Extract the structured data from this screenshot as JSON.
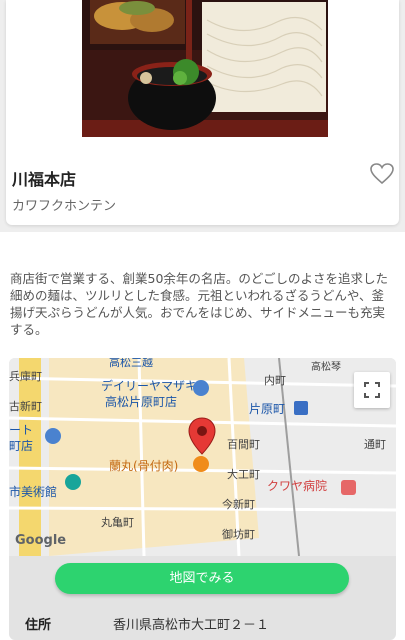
{
  "shop": {
    "name": "川福本店",
    "kana": "カワフクホンテン",
    "description": "商店街で営業する、創業50余年の名店。のどごしのよさを追求した細めの麺は、ツルリとした食感。元祖といわれるざるうどんや、釜揚げ天ぷらうどんが人気。おでんをはじめ、サイドメニューも充実する。"
  },
  "map": {
    "labels": {
      "top_cut": "高松三越",
      "kita": "兵庫町",
      "yamazaki1": "デイリーヤマザキ",
      "yamazaki2": "高松片原町店",
      "uchimachi": "内町",
      "takamatsu_line": "高松琴",
      "katahara_left": "古新町",
      "katahara": "片原町",
      "hyakkenmachi": "百間町",
      "toorimachi": "通町",
      "store_left1": "ート",
      "store_left2": "町店",
      "ranmaru": "蘭丸(骨付肉)",
      "daikumachi": "大工町",
      "museum": "市美術館",
      "imashinmachi": "今新町",
      "kuwaya": "クワヤ病院",
      "marugamemachi": "丸亀町",
      "gofukumachi": "御坊町",
      "google": "Google"
    }
  },
  "map_button": {
    "label": "地図でみる"
  },
  "address": {
    "label": "住所",
    "value": "香川県高松市大工町２－１"
  },
  "colors": {
    "accent": "#2dd36f",
    "pin": "#e53935",
    "text": "#222222"
  }
}
